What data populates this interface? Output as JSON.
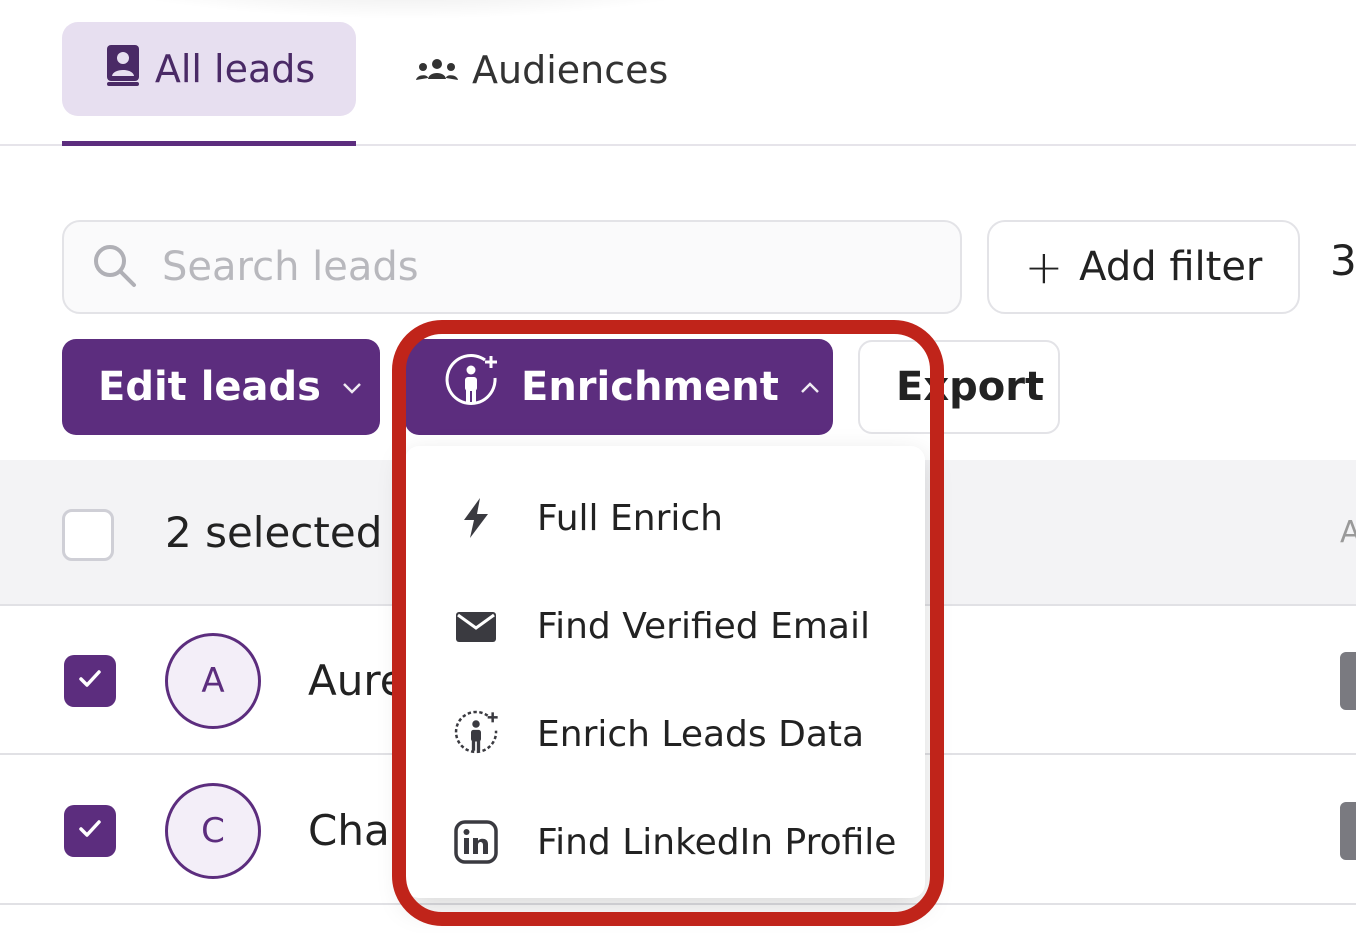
{
  "tabs": {
    "all_leads": "All leads",
    "audiences": "Audiences"
  },
  "search": {
    "placeholder": "Search leads"
  },
  "filter": {
    "add_filter_label": "Add filter",
    "count_cut": "3"
  },
  "actions": {
    "edit_leads_label": "Edit leads",
    "enrichment_label": "Enrichment",
    "export_label": "Export"
  },
  "table": {
    "selected_text": "2 selected",
    "header_cut": "A",
    "rows": [
      {
        "avatar": "A",
        "name": "Aure",
        "checked": true
      },
      {
        "avatar": "C",
        "name": "Cha",
        "checked": true
      }
    ]
  },
  "enrichment_menu": {
    "items": [
      {
        "label": "Full Enrich",
        "icon": "lightning-icon"
      },
      {
        "label": "Find Verified Email",
        "icon": "envelope-icon"
      },
      {
        "label": "Enrich Leads Data",
        "icon": "person-enrich-icon"
      },
      {
        "label": "Find LinkedIn Profile",
        "icon": "linkedin-icon"
      }
    ]
  },
  "colors": {
    "primary": "#5c2d7e",
    "tab_active_bg": "#e7dff0",
    "annotation": "#c0241a"
  }
}
